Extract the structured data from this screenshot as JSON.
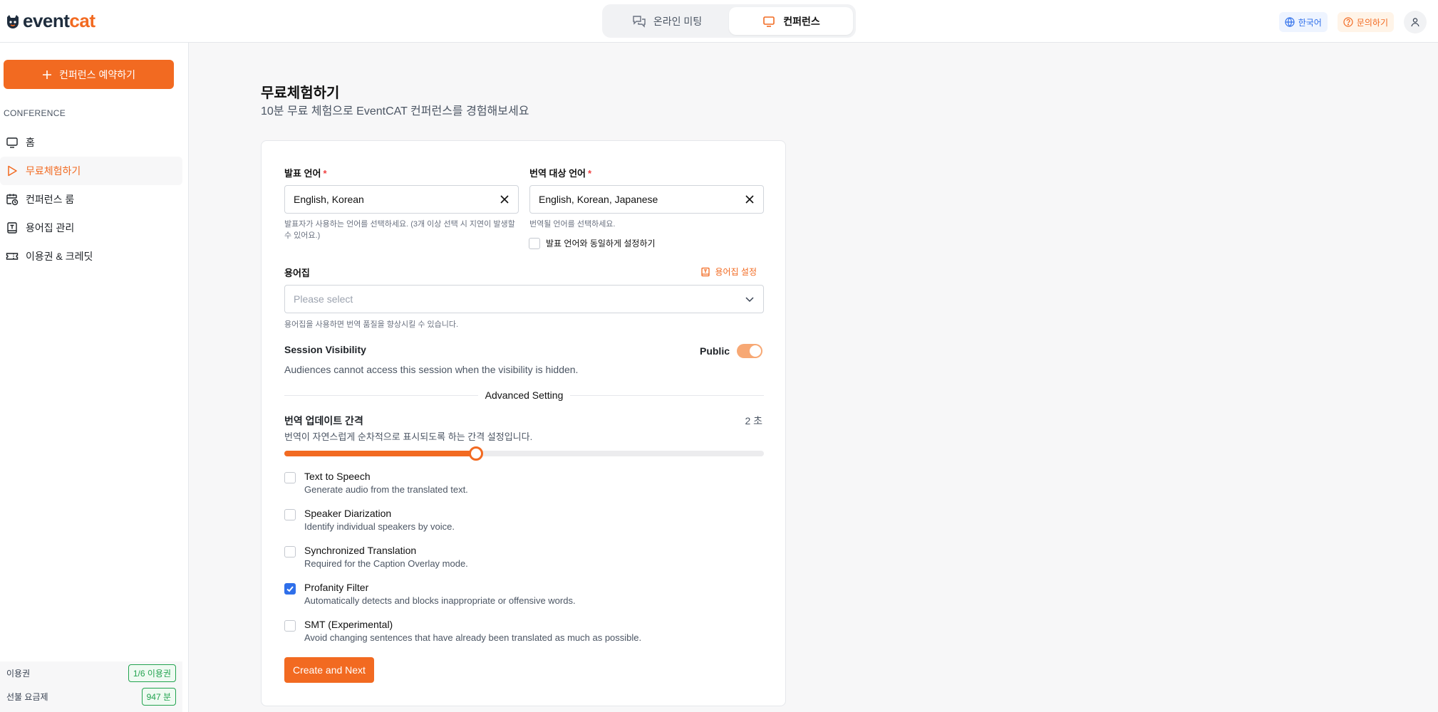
{
  "header": {
    "logo_text_a": "event",
    "logo_text_b": "cat",
    "tabs": [
      {
        "label": "온라인 미팅",
        "active": false
      },
      {
        "label": "컨퍼런스",
        "active": true
      }
    ],
    "language_label": "한국어",
    "help_label": "문의하기"
  },
  "sidebar": {
    "reserve_label": "컨퍼런스 예약하기",
    "section_label": "CONFERENCE",
    "items": [
      {
        "label": "홈",
        "icon": "monitor-icon"
      },
      {
        "label": "무료체험하기",
        "icon": "play-icon",
        "active": true
      },
      {
        "label": "컨퍼런스 룸",
        "icon": "calendar-clock-icon"
      },
      {
        "label": "용어집 관리",
        "icon": "glossary-book-icon"
      },
      {
        "label": "이용권 & 크레딧",
        "icon": "ticket-icon"
      }
    ],
    "quota": {
      "ticket_label": "이용권",
      "ticket_value": "1/6 이용권",
      "prepaid_label": "선불 요금제",
      "prepaid_value": "947 분"
    }
  },
  "main": {
    "title": "무료체험하기",
    "subtitle": "10분 무료 체험으로 EventCAT 컨퍼런스를 경험해보세요",
    "form": {
      "source_lang": {
        "label": "발표 언어",
        "required_mark": "*",
        "value": "English, Korean",
        "hint": "발표자가 사용하는 언어를 선택하세요. (3개 이상 선택 시 지연이 발생할 수 있어요.)"
      },
      "target_lang": {
        "label": "번역 대상 언어",
        "required_mark": "*",
        "value": "English, Korean, Japanese",
        "hint": "번역될 언어를 선택하세요.",
        "same_as_source_label": "발표 언어와 동일하게 설정하기",
        "same_as_source_checked": false
      },
      "glossary": {
        "label": "용어집",
        "settings_label": "용어집 설정",
        "placeholder": "Please select",
        "hint": "용어집을 사용하면 번역 품질을 향상시킬 수 있습니다."
      },
      "visibility": {
        "label": "Session Visibility",
        "state_label": "Public",
        "enabled": true,
        "description": "Audiences cannot access this session when the visibility is hidden."
      },
      "advanced_title": "Advanced Setting",
      "interval": {
        "label": "번역 업데이트 간격",
        "value_text": "2 초",
        "description": "번역이 자연스럽게 순차적으로 표시되도록 하는 간격 설정입니다.",
        "slider_fraction": 0.4
      },
      "options": [
        {
          "title": "Text to Speech",
          "desc": "Generate audio from the translated text.",
          "checked": false
        },
        {
          "title": "Speaker Diarization",
          "desc": "Identify individual speakers by voice.",
          "checked": false
        },
        {
          "title": "Synchronized Translation",
          "desc": "Required for the Caption Overlay mode.",
          "checked": false
        },
        {
          "title": "Profanity Filter",
          "desc": "Automatically detects and blocks inappropriate or offensive words.",
          "checked": true
        },
        {
          "title": "SMT (Experimental)",
          "desc": "Avoid changing sentences that have already been translated as much as possible.",
          "checked": false
        }
      ],
      "submit_label": "Create and Next"
    }
  },
  "colors": {
    "accent": "#f26a21",
    "checkbox_checked": "#2f6fea",
    "quota_green": "#22a34f"
  }
}
